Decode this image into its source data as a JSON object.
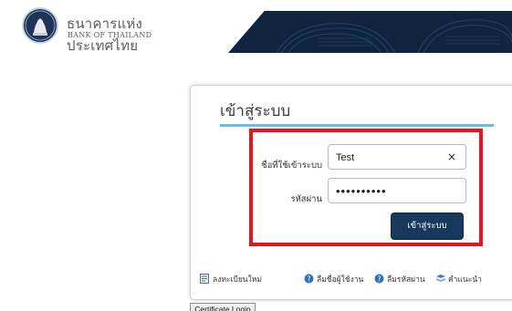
{
  "header": {
    "bank_name_th": "ธนาคารแห่งประเทศไทย",
    "bank_name_en": "BANK OF THAILAND",
    "logo_icon": "bank-of-thailand-seal-icon",
    "band_color": "#10243f"
  },
  "login": {
    "title": "เข้าสู่ระบบ",
    "username_label": "ชื่อที่ใช้เข้าระบบ",
    "username_value": "Test",
    "clear_icon_glyph": "×",
    "password_label": "รหัสผ่าน",
    "password_value": "••••••••••",
    "submit_label": "เข้าสู่ระบบ",
    "accent_color": "#75b6e4",
    "highlight_color": "#e8141c",
    "button_color": "#18395e"
  },
  "links": {
    "register": {
      "label": "ลงทะเบียนใหม่",
      "icon": "register-form-icon"
    },
    "forgot_username": {
      "label": "ลืมชื่อผู้ใช้งาน",
      "icon": "help-question-icon"
    },
    "forgot_password": {
      "label": "ลืมรหัสผ่าน",
      "icon": "help-question-icon"
    },
    "help": {
      "label": "คำแนะนำ",
      "icon": "guide-book-icon"
    }
  },
  "certificate_login_label": "Certificate Login"
}
